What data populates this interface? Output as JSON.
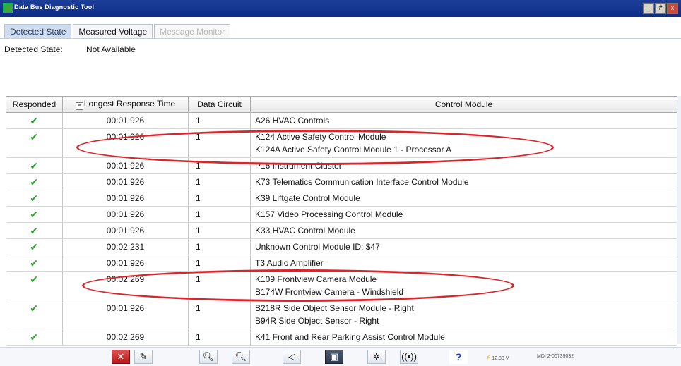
{
  "window": {
    "title": "Data Bus Diagnostic Tool",
    "buttons": [
      "_",
      "#",
      "x"
    ]
  },
  "tabs": [
    {
      "label": "Detected State",
      "state": "active"
    },
    {
      "label": "Measured Voltage",
      "state": "normal"
    },
    {
      "label": "Message Monitor",
      "state": "disabled"
    }
  ],
  "detected_state": {
    "label": "Detected State:",
    "value": "Not Available"
  },
  "table": {
    "headers": [
      "Responded",
      "Longest Response Time",
      "Data Circuit",
      "Control Module"
    ],
    "rows": [
      {
        "check": "✔",
        "time": "00:01:926",
        "circuit": "1",
        "modules": [
          "A26 HVAC Controls"
        ]
      },
      {
        "check": "✔",
        "time": "00:01:926",
        "circuit": "1",
        "modules": [
          "K124 Active Safety Control Module",
          "K124A Active Safety Control Module 1 - Processor A"
        ]
      },
      {
        "check": "✔",
        "time": "00:01:926",
        "circuit": "1",
        "modules": [
          "P16 Instrument Cluster"
        ]
      },
      {
        "check": "✔",
        "time": "00:01:926",
        "circuit": "1",
        "modules": [
          "K73 Telematics Communication Interface Control Module"
        ]
      },
      {
        "check": "✔",
        "time": "00:01:926",
        "circuit": "1",
        "modules": [
          "K39 Liftgate Control Module"
        ]
      },
      {
        "check": "✔",
        "time": "00:01:926",
        "circuit": "1",
        "modules": [
          "K157 Video Processing Control Module"
        ]
      },
      {
        "check": "✔",
        "time": "00:01:926",
        "circuit": "1",
        "modules": [
          "K33 HVAC Control Module"
        ]
      },
      {
        "check": "✔",
        "time": "00:02:231",
        "circuit": "1",
        "modules": [
          "Unknown Control Module ID: $47"
        ]
      },
      {
        "check": "✔",
        "time": "00:01:926",
        "circuit": "1",
        "modules": [
          "T3 Audio Amplifier"
        ]
      },
      {
        "check": "✔",
        "time": "00:02:269",
        "circuit": "1",
        "modules": [
          "K109 Frontview Camera Module",
          "B174W Frontview Camera - Windshield"
        ]
      },
      {
        "check": "✔",
        "time": "00:01:926",
        "circuit": "1",
        "modules": [
          "B218R Side Object Sensor Module - Right",
          "B94R Side Object Sensor - Right"
        ]
      },
      {
        "check": "✔",
        "time": "00:02:269",
        "circuit": "1",
        "modules": [
          "K41 Front and Rear Parking Assist Control Module"
        ]
      }
    ]
  },
  "toolbar": {
    "icons": [
      "exit-icon",
      "pencil-icon",
      "zoom-in-icon",
      "zoom-out-icon",
      "speaker-icon",
      "camera-icon",
      "settings-icon",
      "signal-icon",
      "help-icon"
    ],
    "help_label": "?",
    "voltage": "12.83 V",
    "mdi": "MDI 2-00739032"
  },
  "colors": {
    "titlebar": "#0c2c86",
    "active_tab": "#cfdcef",
    "check": "#2aa12a",
    "highlight_ellipse": "#d9262c"
  }
}
